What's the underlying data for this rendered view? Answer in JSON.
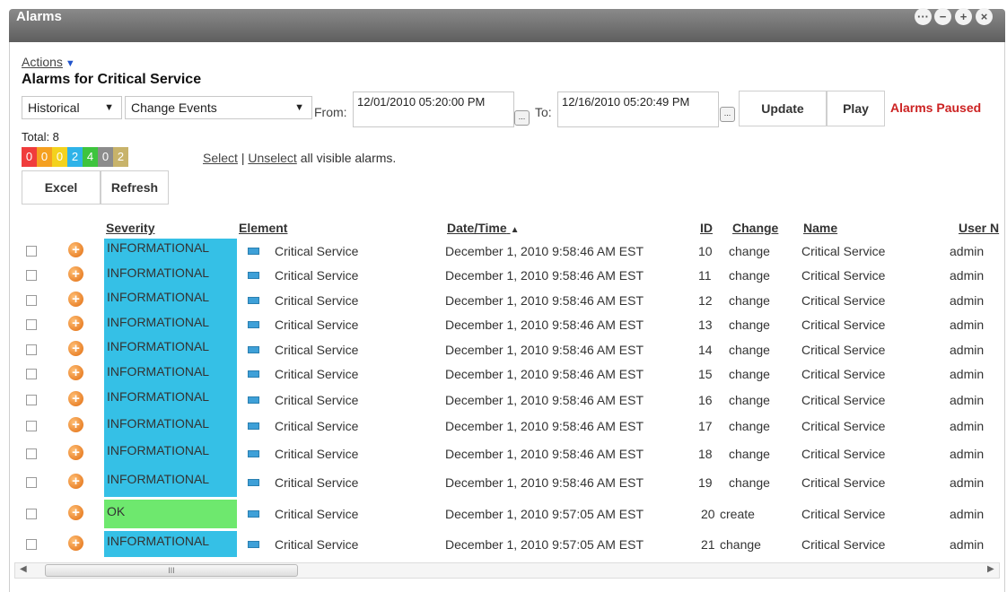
{
  "window": {
    "title": "Alarms",
    "controls": [
      "···",
      "−",
      "+",
      "×"
    ]
  },
  "toolbar": {
    "actions_label": "Actions",
    "actions_caret": "▼",
    "subtitle": "Alarms for Critical Service",
    "mode_select": "Historical",
    "event_select": "Change Events",
    "from_label": "From:",
    "from_value": "12/01/2010 05:20:00 PM",
    "to_label": "To:",
    "to_value": "12/16/2010 05:20:49 PM",
    "picker_label": "...",
    "update_label": "Update",
    "play_label": "Play",
    "status_text": "Alarms Paused"
  },
  "summary": {
    "total_label": "Total: 8",
    "counts": [
      {
        "value": "0",
        "color": "#f03c3c"
      },
      {
        "value": "0",
        "color": "#f5a020"
      },
      {
        "value": "0",
        "color": "#f3d21e"
      },
      {
        "value": "2",
        "color": "#2fb3e8"
      },
      {
        "value": "4",
        "color": "#3ec43e"
      },
      {
        "value": "0",
        "color": "#8c8c8c"
      },
      {
        "value": "2",
        "color": "#c8b36a"
      }
    ],
    "select_link": "Select",
    "separator": "|",
    "unselect_link": "Unselect",
    "select_suffix": "all visible alarms.",
    "excel_label": "Excel",
    "refresh_label": "Refresh"
  },
  "table": {
    "columns": [
      "Severity",
      "Element",
      "Date/Time",
      "ID",
      "Change",
      "Name",
      "User N"
    ],
    "sort_indicator": "▲",
    "rows": [
      {
        "severity": "INFORMATIONAL",
        "element": "Critical Service",
        "datetime": "December 1, 2010 9:58:46 AM EST",
        "id": "10",
        "change": "change",
        "name": "Critical Service",
        "user": "admin"
      },
      {
        "severity": "INFORMATIONAL",
        "element": "Critical Service",
        "datetime": "December 1, 2010 9:58:46 AM EST",
        "id": "11",
        "change": "change",
        "name": "Critical Service",
        "user": "admin"
      },
      {
        "severity": "INFORMATIONAL",
        "element": "Critical Service",
        "datetime": "December 1, 2010 9:58:46 AM EST",
        "id": "12",
        "change": "change",
        "name": "Critical Service",
        "user": "admin"
      },
      {
        "severity": "INFORMATIONAL",
        "element": "Critical Service",
        "datetime": "December 1, 2010 9:58:46 AM EST",
        "id": "13",
        "change": "change",
        "name": "Critical Service",
        "user": "admin"
      },
      {
        "severity": "INFORMATIONAL",
        "element": "Critical Service",
        "datetime": "December 1, 2010 9:58:46 AM EST",
        "id": "14",
        "change": "change",
        "name": "Critical Service",
        "user": "admin"
      },
      {
        "severity": "INFORMATIONAL",
        "element": "Critical Service",
        "datetime": "December 1, 2010 9:58:46 AM EST",
        "id": "15",
        "change": "change",
        "name": "Critical Service",
        "user": "admin"
      },
      {
        "severity": "INFORMATIONAL",
        "element": "Critical Service",
        "datetime": "December 1, 2010 9:58:46 AM EST",
        "id": "16",
        "change": "change",
        "name": "Critical Service",
        "user": "admin"
      },
      {
        "severity": "INFORMATIONAL",
        "element": "Critical Service",
        "datetime": "December 1, 2010 9:58:46 AM EST",
        "id": "17",
        "change": "change",
        "name": "Critical Service",
        "user": "admin"
      },
      {
        "severity": "INFORMATIONAL",
        "element": "Critical Service",
        "datetime": "December 1, 2010 9:58:46 AM EST",
        "id": "18",
        "change": "change",
        "name": "Critical Service",
        "user": "admin"
      },
      {
        "severity": "INFORMATIONAL",
        "element": "Critical Service",
        "datetime": "December 1, 2010 9:58:46 AM EST",
        "id": "19",
        "change": "change",
        "name": "Critical Service",
        "user": "admin"
      },
      {
        "severity": "OK",
        "element": "Critical Service",
        "datetime": "December 1, 2010 9:57:05 AM EST",
        "id": "20",
        "change": "create",
        "name": "Critical Service",
        "user": "admin"
      },
      {
        "severity": "INFORMATIONAL",
        "element": "Critical Service",
        "datetime": "December 1, 2010 9:57:05 AM EST",
        "id": "21",
        "change": "change",
        "name": "Critical Service",
        "user": "admin"
      }
    ]
  },
  "colors": {
    "informational": "#35c0e6",
    "ok": "#6ee86e",
    "status_paused": "#cc2222"
  },
  "icons": {
    "severity_icon": "plus-circle-icon",
    "element_icon": "service-icon"
  },
  "scrollbar": {
    "grip": "III",
    "left_arrow": "◀",
    "right_arrow": "▶"
  }
}
